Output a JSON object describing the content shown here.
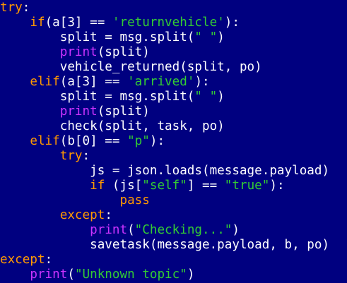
{
  "editor": {
    "background": "#000080",
    "colors": {
      "keyword": "#ff9900",
      "builtin": "#cc33ff",
      "string": "#33cc33",
      "text": "#ffffff"
    },
    "lines": [
      [
        {
          "t": "kw",
          "v": "try"
        },
        {
          "t": "tx",
          "v": ":"
        }
      ],
      [
        {
          "t": "tx",
          "v": "    "
        },
        {
          "t": "kw",
          "v": "if"
        },
        {
          "t": "tx",
          "v": "(a[3] == "
        },
        {
          "t": "str",
          "v": "'returnvehicle'"
        },
        {
          "t": "tx",
          "v": "):"
        }
      ],
      [
        {
          "t": "tx",
          "v": "        split = msg.split("
        },
        {
          "t": "str",
          "v": "\" \""
        },
        {
          "t": "tx",
          "v": ")"
        }
      ],
      [
        {
          "t": "tx",
          "v": "        "
        },
        {
          "t": "bi",
          "v": "print"
        },
        {
          "t": "tx",
          "v": "(split)"
        }
      ],
      [
        {
          "t": "tx",
          "v": "        vehicle_returned(split, po)"
        }
      ],
      [
        {
          "t": "tx",
          "v": "    "
        },
        {
          "t": "kw",
          "v": "elif"
        },
        {
          "t": "tx",
          "v": "(a[3] == "
        },
        {
          "t": "str",
          "v": "'arrived'"
        },
        {
          "t": "tx",
          "v": "):"
        }
      ],
      [
        {
          "t": "tx",
          "v": "        split = msg.split("
        },
        {
          "t": "str",
          "v": "\" \""
        },
        {
          "t": "tx",
          "v": ")"
        }
      ],
      [
        {
          "t": "tx",
          "v": "        "
        },
        {
          "t": "bi",
          "v": "print"
        },
        {
          "t": "tx",
          "v": "(split)"
        }
      ],
      [
        {
          "t": "tx",
          "v": "        check(split, task, po)"
        }
      ],
      [
        {
          "t": "tx",
          "v": "    "
        },
        {
          "t": "kw",
          "v": "elif"
        },
        {
          "t": "tx",
          "v": "(b[0] == "
        },
        {
          "t": "str",
          "v": "\"p\""
        },
        {
          "t": "tx",
          "v": "):"
        }
      ],
      [
        {
          "t": "tx",
          "v": "        "
        },
        {
          "t": "kw",
          "v": "try"
        },
        {
          "t": "tx",
          "v": ":"
        }
      ],
      [
        {
          "t": "tx",
          "v": "            js = json.loads(message.payload)"
        }
      ],
      [
        {
          "t": "tx",
          "v": "            "
        },
        {
          "t": "kw",
          "v": "if"
        },
        {
          "t": "tx",
          "v": " (js["
        },
        {
          "t": "str",
          "v": "\"self\""
        },
        {
          "t": "tx",
          "v": "] == "
        },
        {
          "t": "str",
          "v": "\"true\""
        },
        {
          "t": "tx",
          "v": "):"
        }
      ],
      [
        {
          "t": "tx",
          "v": "                "
        },
        {
          "t": "kw",
          "v": "pass"
        }
      ],
      [
        {
          "t": "tx",
          "v": "        "
        },
        {
          "t": "kw",
          "v": "except"
        },
        {
          "t": "tx",
          "v": ":"
        }
      ],
      [
        {
          "t": "tx",
          "v": "            "
        },
        {
          "t": "bi",
          "v": "print"
        },
        {
          "t": "tx",
          "v": "("
        },
        {
          "t": "str",
          "v": "\"Checking...\""
        },
        {
          "t": "tx",
          "v": ")"
        }
      ],
      [
        {
          "t": "tx",
          "v": "            savetask(message.payload, b, po)"
        }
      ],
      [
        {
          "t": "kw",
          "v": "except"
        },
        {
          "t": "tx",
          "v": ":"
        }
      ],
      [
        {
          "t": "tx",
          "v": "    "
        },
        {
          "t": "bi",
          "v": "print"
        },
        {
          "t": "tx",
          "v": "("
        },
        {
          "t": "str",
          "v": "\"Unknown topic\""
        },
        {
          "t": "tx",
          "v": ")"
        }
      ]
    ]
  }
}
